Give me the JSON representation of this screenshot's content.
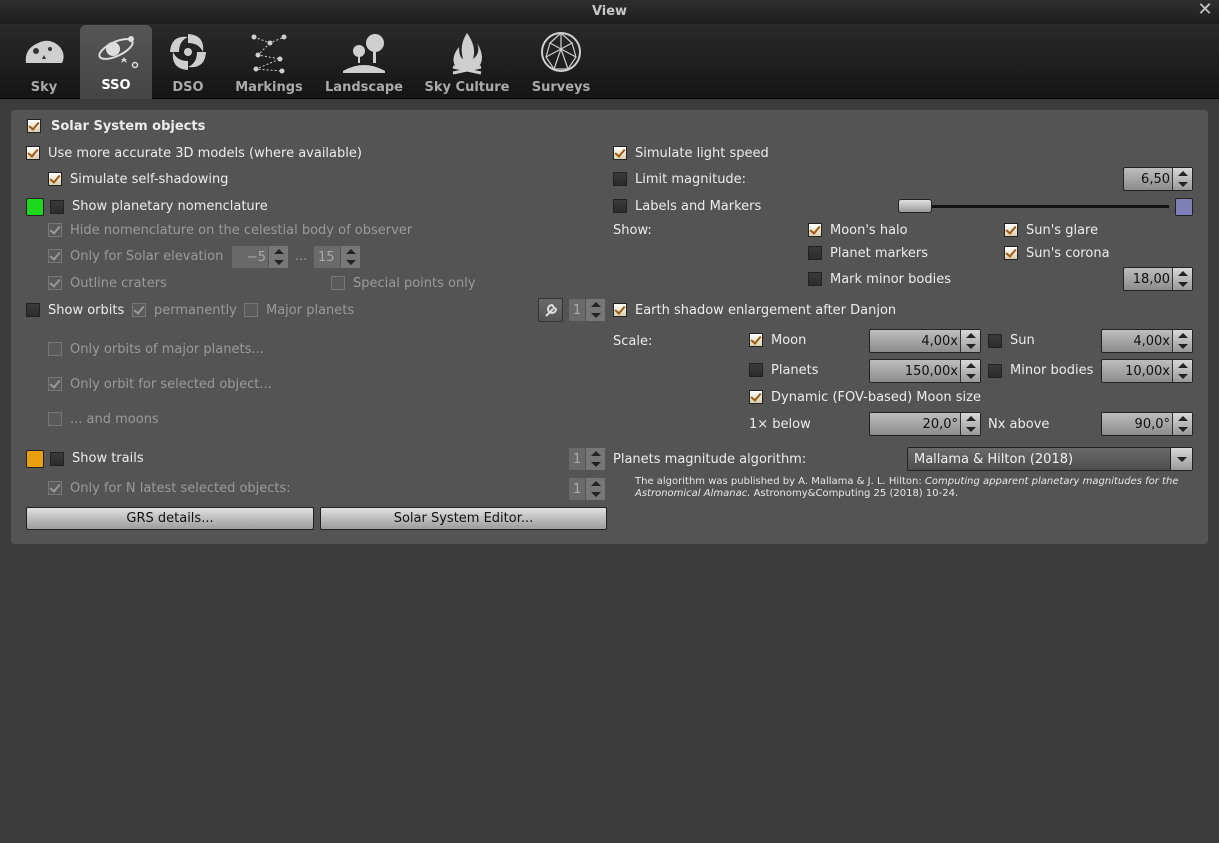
{
  "window": {
    "title": "View"
  },
  "tabs": [
    {
      "label": "Sky",
      "icon": "sky-icon"
    },
    {
      "label": "SSO",
      "icon": "sso-icon",
      "active": true
    },
    {
      "label": "DSO",
      "icon": "dso-icon"
    },
    {
      "label": "Markings",
      "icon": "markings-icon"
    },
    {
      "label": "Landscape",
      "icon": "landscape-icon"
    },
    {
      "label": "Sky Culture",
      "icon": "sky-culture-icon"
    },
    {
      "label": "Surveys",
      "icon": "surveys-icon"
    }
  ],
  "left": {
    "solar_system_objects": "Solar System objects",
    "accurate_3d": "Use more accurate 3D models (where available)",
    "self_shadowing": "Simulate self-shadowing",
    "nomenclature": "Show planetary nomenclature",
    "nomenclature_color": "#1ed81e",
    "hide_nomenclature": "Hide nomenclature on the celestial body of observer",
    "only_solar_elevation": "Only for Solar elevation",
    "elev_min": "−5",
    "elev_sep": "...",
    "elev_max": "15",
    "outline_craters": "Outline craters",
    "special_points": "Special points only",
    "show_orbits": "Show orbits",
    "permanently": "permanently",
    "major_planets": "Major planets",
    "orbit_width": "1",
    "only_orbits_major": "Only orbits of major planets...",
    "only_orbit_selected": "Only orbit for selected object...",
    "and_moons": "... and moons",
    "show_trails": "Show trails",
    "trails_color": "#e8a010",
    "trails_width": "1",
    "only_n_latest": "Only for N latest selected objects:",
    "n_latest": "1",
    "grs_button": "GRS details...",
    "editor_button": "Solar System Editor..."
  },
  "right": {
    "light_speed": "Simulate light speed",
    "limit_magnitude": "Limit magnitude:",
    "limit_magnitude_value": "6,50",
    "labels_markers": "Labels and Markers",
    "labels_color": "#8080b8",
    "labels_slider_level": 0.02,
    "show_label": "Show:",
    "moons_halo": "Moon's halo",
    "suns_glare": "Sun's glare",
    "planet_markers": "Planet markers",
    "suns_corona": "Sun's corona",
    "mark_minor": "Mark minor bodies",
    "mark_minor_value": "18,00",
    "earth_shadow": "Earth shadow enlargement after Danjon",
    "scale_label": "Scale:",
    "moon": "Moon",
    "moon_scale": "4,00x",
    "sun": "Sun",
    "sun_scale": "4,00x",
    "planets": "Planets",
    "planets_scale": "150,00x",
    "minor_bodies": "Minor bodies",
    "minor_scale": "10,00x",
    "dynamic_moon": "Dynamic (FOV-based) Moon size",
    "below_label": "1× below",
    "below_value": "20,0°",
    "above_label": "Nx above",
    "above_value": "90,0°",
    "mag_algo_label": "Planets magnitude algorithm:",
    "mag_algo_value": "Mallama & Hilton (2018)",
    "note_line1_a": "The algorithm was published by A. Mallama & J. L. Hilton: ",
    "note_line1_b": "Computing apparent planetary magnitudes for the",
    "note_line2_a": "Astronomical Almanac.",
    "note_line2_b": " Astronomy&Computing 25 (2018) 10-24."
  }
}
